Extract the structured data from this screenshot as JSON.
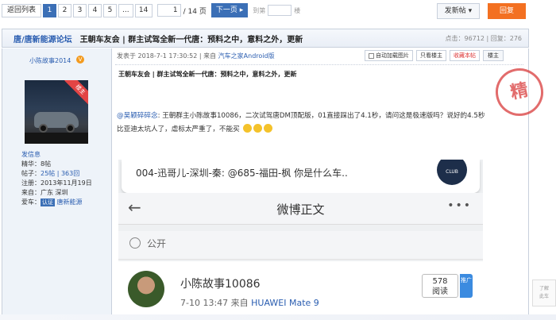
{
  "pager": {
    "back": "返回列表",
    "pages": [
      "1",
      "2",
      "3",
      "4",
      "5",
      "...",
      "14"
    ],
    "current": "1",
    "input_value": "1",
    "total": "/ 14 页",
    "next": "下一页 ▸",
    "goto_prefix": "到第",
    "goto_suffix": "楼"
  },
  "toolbar": {
    "new_post": "发新帖 ▾",
    "reply": "回复"
  },
  "thread": {
    "forum": "唐/唐新能源论坛",
    "title": "王朝车友会 | 群主试驾全新一代唐：预料之中，意料之外，更新",
    "stats": "点击：96712 | 回复：276"
  },
  "user": {
    "name": "小陈故事2014",
    "badge": "V",
    "ribbon": "楼主",
    "message": "发信息",
    "rows": [
      {
        "k": "精华：",
        "v": "8帖"
      },
      {
        "k": "帖子：",
        "v": "25帖 | 363回"
      },
      {
        "k": "注册：",
        "v": "2013年11月19日"
      },
      {
        "k": "来自：",
        "v": "广东 深圳"
      }
    ],
    "car_label": "爱车：",
    "car_tag": "认证",
    "car_name": "唐新能源"
  },
  "post": {
    "meta_prefix": "发表于 2018-7-1 17:30:52 | 来自 ",
    "meta_source": "汽车之家Android版",
    "opt_autoload": "自动加载图片",
    "opt_author": "只看楼主",
    "opt_fav": "收藏本帖",
    "floor": "楼主",
    "title": "王朝车友会 | 群主试驾全新一代唐：预料之中，意料之外，更新",
    "mention": "@吴颖碎碎念",
    "body_line1": ": 王朝群主小陈故事10086，二次试驾唐DM顶配版，01直接踩出了4.1秒，请问这是极速版吗？说好的4.5秒",
    "body_line2": "比亚迪太坑人了，虐标太严重了，不能买",
    "stamp": "精"
  },
  "screenshot": {
    "notification": "004-迅哥儿-深圳-秦: @685-福田-枫 你是什么车..",
    "club": "CLUB",
    "header_title": "微博正文",
    "more": "•••",
    "public": "公开",
    "username": "小陈故事10086",
    "time_prefix": "7-10 13:47  来自 ",
    "device": "HUAWEI Mate 9",
    "reads": "578",
    "reads_label": "阅读",
    "promo": "推广"
  },
  "side_tab": "了解\n此车"
}
